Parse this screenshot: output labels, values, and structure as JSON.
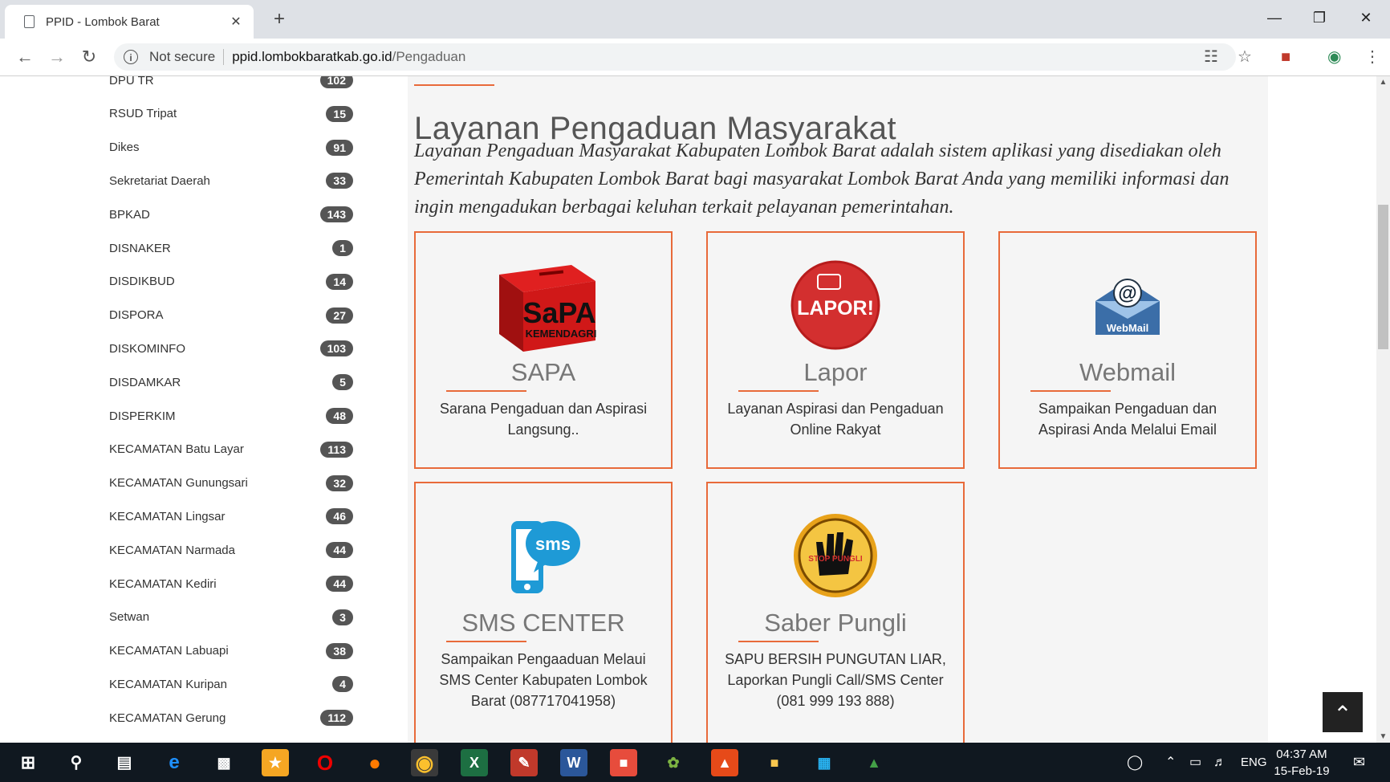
{
  "browser": {
    "tab_title": "PPID - Lombok Barat",
    "tab_close": "✕",
    "new_tab": "+",
    "security": "Not secure",
    "url_host": "ppid.lombokbaratkab.go.id",
    "url_path": "/Pengaduan",
    "info_glyph": "i"
  },
  "sidebar": {
    "items": [
      {
        "label": "DPU TR",
        "count": "102"
      },
      {
        "label": "RSUD Tripat",
        "count": "15"
      },
      {
        "label": "Dikes",
        "count": "91"
      },
      {
        "label": "Sekretariat Daerah",
        "count": "33"
      },
      {
        "label": "BPKAD",
        "count": "143"
      },
      {
        "label": "DISNAKER",
        "count": "1"
      },
      {
        "label": "DISDIKBUD",
        "count": "14"
      },
      {
        "label": "DISPORA",
        "count": "27"
      },
      {
        "label": "DISKOMINFO",
        "count": "103"
      },
      {
        "label": "DISDAMKAR",
        "count": "5"
      },
      {
        "label": "DISPERKIM",
        "count": "48"
      },
      {
        "label": "KECAMATAN Batu Layar",
        "count": "113"
      },
      {
        "label": "KECAMATAN Gunungsari",
        "count": "32"
      },
      {
        "label": "KECAMATAN Lingsar",
        "count": "46"
      },
      {
        "label": "KECAMATAN Narmada",
        "count": "44"
      },
      {
        "label": "KECAMATAN Kediri",
        "count": "44"
      },
      {
        "label": "Setwan",
        "count": "3"
      },
      {
        "label": "KECAMATAN Labuapi",
        "count": "38"
      },
      {
        "label": "KECAMATAN Kuripan",
        "count": "4"
      },
      {
        "label": "KECAMATAN Gerung",
        "count": "112"
      }
    ]
  },
  "main": {
    "title": "Layanan Pengaduan Masyarakat",
    "intro": "Layanan Pengaduan Masyarakat Kabupaten Lombok Barat adalah sistem aplikasi yang disediakan oleh Pemerintah Kabupaten Lombok Barat bagi masyarakat Lombok Barat Anda yang memiliki informasi dan ingin mengadukan berbagai keluhan terkait pelayanan pemerintahan.",
    "cards": [
      {
        "name": "SAPA",
        "desc": "Sarana Pengaduan dan Aspirasi Langsung..",
        "logo_text": "SaPA",
        "logo_sub": "KEMENDAGRI"
      },
      {
        "name": "Lapor",
        "desc": "Layanan Aspirasi dan Pengaduan Online Rakyat",
        "logo_text": "LAPOR!"
      },
      {
        "name": "Webmail",
        "desc": "Sampaikan Pengaduan dan Aspirasi Anda Melalui Email",
        "logo_text": "WebMail"
      },
      {
        "name": "SMS CENTER",
        "desc": "Sampaikan Pengaaduan Melaui SMS Center Kabupaten Lombok Barat (087717041958)",
        "logo_text": "sms"
      },
      {
        "name": "Saber Pungli",
        "desc": "SAPU BERSIH PUNGUTAN LIAR, Laporkan Pungli Call/SMS Center (081 999 193 888)",
        "logo_text": "STOP PUNGLI"
      }
    ]
  },
  "taskbar": {
    "lang": "ENG",
    "time": "04:37 AM",
    "date": "15-Feb-19"
  },
  "colors": {
    "accent": "#e86a3a",
    "badge": "#555555"
  }
}
